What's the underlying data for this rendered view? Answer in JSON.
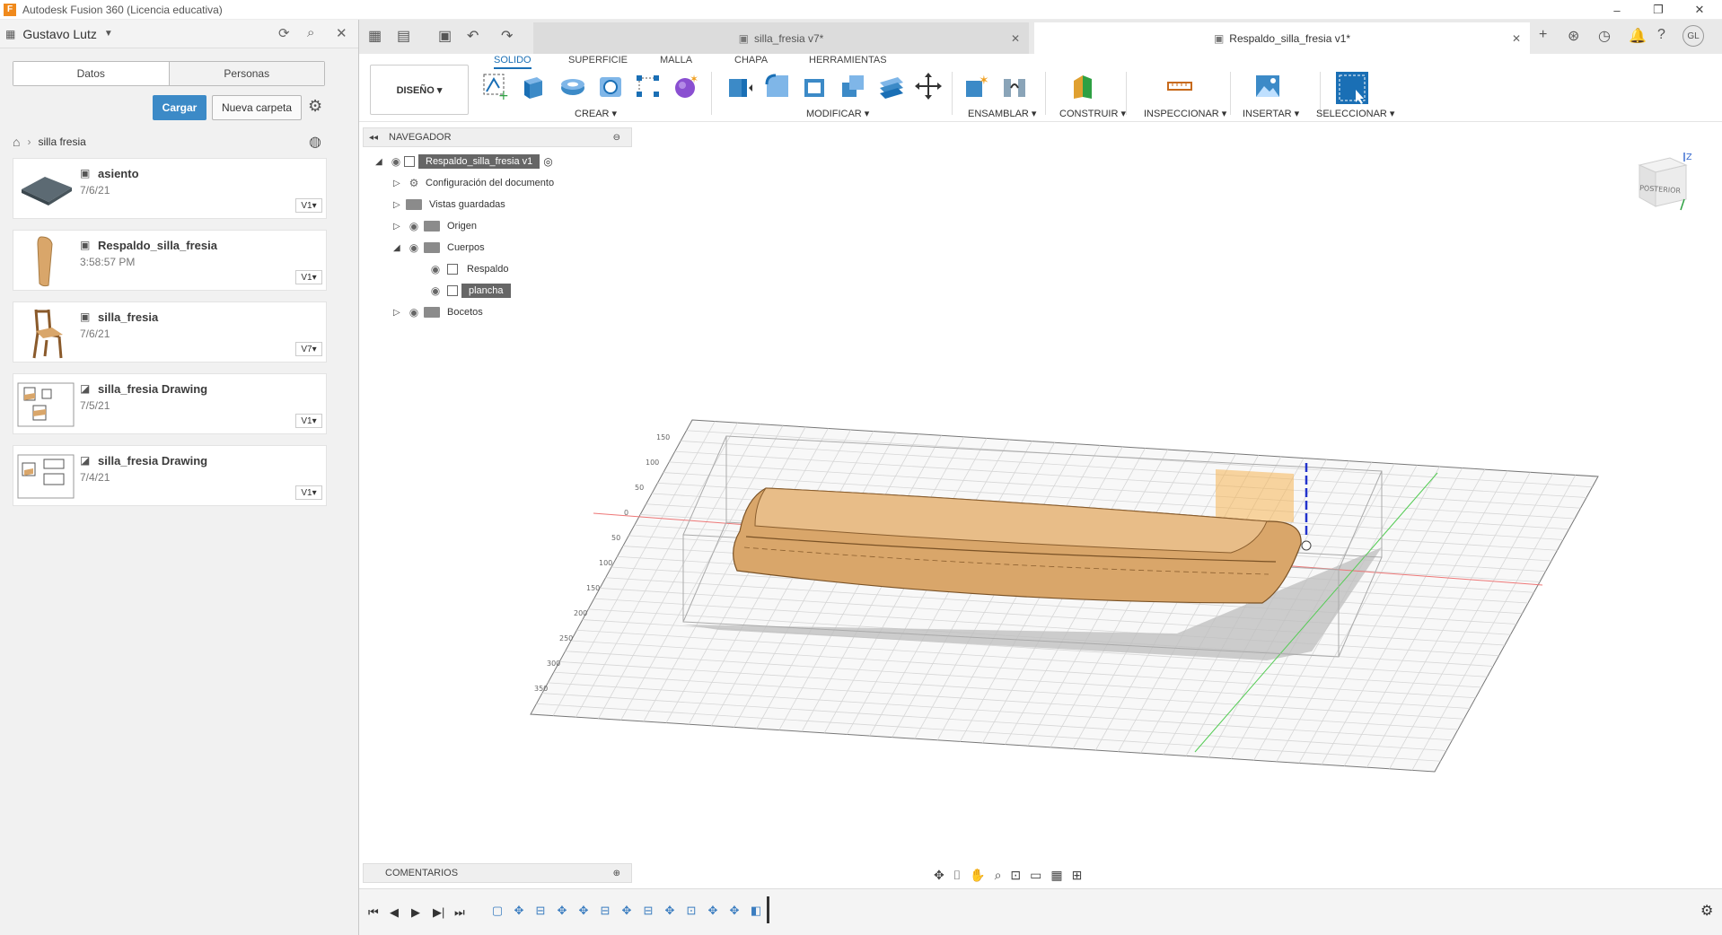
{
  "window": {
    "app_title": "Autodesk Fusion 360 (Licencia educativa)",
    "minimize": "–",
    "restore": "❐",
    "close": "✕"
  },
  "data_panel": {
    "user": "Gustavo Lutz",
    "tabs": [
      "Datos",
      "Personas"
    ],
    "upload_label": "Cargar",
    "new_folder_label": "Nueva carpeta",
    "breadcrumb": "silla fresia",
    "files": [
      {
        "name": "asiento",
        "date": "7/6/21",
        "version": "V1▾"
      },
      {
        "name": "Respaldo_silla_fresia",
        "date": "3:58:57 PM",
        "version": "V1▾"
      },
      {
        "name": "silla_fresia",
        "date": "7/6/21",
        "version": "V7▾"
      },
      {
        "name": "silla_fresia Drawing",
        "date": "7/5/21",
        "version": "V1▾"
      },
      {
        "name": "silla_fresia Drawing",
        "date": "7/4/21",
        "version": "V1▾"
      }
    ]
  },
  "doc_tabs": [
    {
      "label": "silla_fresia v7*",
      "active": false
    },
    {
      "label": "Respaldo_silla_fresia v1*",
      "active": true
    }
  ],
  "user_initials": "GL",
  "ribbon": {
    "workspace": "DISEÑO ▾",
    "tabs": [
      "SOLIDO",
      "SUPERFICIE",
      "MALLA",
      "CHAPA",
      "HERRAMIENTAS"
    ],
    "groups": [
      "CREAR ▾",
      "MODIFICAR ▾",
      "ENSAMBLAR ▾",
      "CONSTRUIR ▾",
      "INSPECCIONAR ▾",
      "INSERTAR ▾",
      "SELECCIONAR ▾"
    ]
  },
  "browser": {
    "title": "NAVEGADOR",
    "root": "Respaldo_silla_fresia v1",
    "items": [
      "Configuración del documento",
      "Vistas guardadas",
      "Origen",
      "Cuerpos",
      "Respaldo",
      "plancha",
      "Bocetos"
    ]
  },
  "viewcube_label": "POSTERIOR",
  "viewcube_axis": "Z",
  "comments_label": "COMENTARIOS",
  "grid_labels": [
    "150",
    "100",
    "50",
    "0",
    "50",
    "100",
    "150",
    "200",
    "250",
    "300",
    "350"
  ],
  "colors": {
    "accent": "#3c8ac7",
    "body": "#d9a66a",
    "highlight": "#f5b554"
  }
}
